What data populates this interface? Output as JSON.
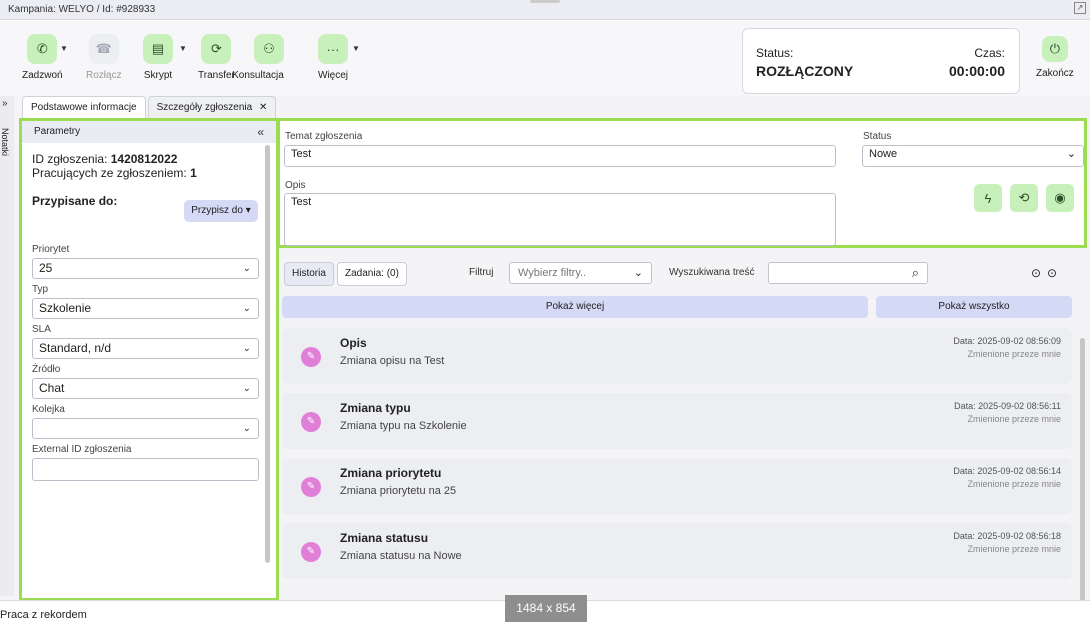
{
  "window": {
    "title": "Kampania: WELYO / Id: #928933",
    "expand_icon": "expand-icon"
  },
  "toolbar": {
    "call": "Zadzwoń",
    "hangup": "Rozłącz",
    "script": "Skrypt",
    "transfer": "Transfer",
    "consult": "Konsultacja",
    "more": "Więcej",
    "end": "Zakończ"
  },
  "status": {
    "status_label": "Status:",
    "status_value": "ROZŁĄCZONY",
    "time_label": "Czas:",
    "time_value": "00:00:00"
  },
  "side": {
    "notes_label": "Notatki",
    "toggle": "»"
  },
  "tabs": [
    {
      "label": "Podstawowe informacje"
    },
    {
      "label": "Szczegóły zgłoszenia",
      "close": "✕"
    }
  ],
  "params": {
    "header": "Parametry",
    "collapse": "«",
    "id_label": "ID zgłoszenia:",
    "id_value": "1420812022",
    "working_label": "Pracujących ze zgłoszeniem:",
    "working_value": "1",
    "assigned_label": "Przypisane do:",
    "assign_button": "Przypisz do ▾",
    "priority_label": "Priorytet",
    "priority_value": "25",
    "type_label": "Typ",
    "type_value": "Szkolenie",
    "sla_label": "SLA",
    "sla_value": "Standard, n/d",
    "source_label": "Źródło",
    "source_value": "Chat",
    "queue_label": "Kolejka",
    "queue_value": "",
    "external_label": "External ID zgłoszenia",
    "external_value": ""
  },
  "ticket": {
    "subject_label": "Temat zgłoszenia",
    "subject_value": "Test",
    "status_label": "Status",
    "status_value": "Nowe",
    "desc_label": "Opis",
    "desc_value": "Test"
  },
  "history": {
    "tab_history": "Historia",
    "tab_tasks": "Zadania: (0)",
    "filter_label": "Filtruj",
    "filter_placeholder": "Wybierz filtry..",
    "search_label": "Wyszukiwana treść",
    "search_value": "",
    "show_more": "Pokaż więcej",
    "show_all": "Pokaż wszystko",
    "events": [
      {
        "title": "Opis",
        "desc": "Zmiana opisu na Test",
        "date": "Data: 2025-09-02 08:56:09",
        "by": "Zmienione przeze mnie"
      },
      {
        "title": "Zmiana typu",
        "desc": "Zmiana typu na Szkolenie",
        "date": "Data: 2025-09-02 08:56:11",
        "by": "Zmienione przeze mnie"
      },
      {
        "title": "Zmiana priorytetu",
        "desc": "Zmiana priorytetu na 25",
        "date": "Data: 2025-09-02 08:56:14",
        "by": "Zmienione przeze mnie"
      },
      {
        "title": "Zmiana statusu",
        "desc": "Zmiana statusu na Nowe",
        "date": "Data: 2025-09-02 08:56:18",
        "by": "Zmienione przeze mnie"
      }
    ]
  },
  "footer": {
    "text": "Praca z rekordem"
  },
  "overlay": {
    "dimensions": "1484 x 854"
  },
  "colors": {
    "accent_green": "#c8f0ba",
    "highlight_border": "#9bdc50",
    "button_blue": "#d4d9f6",
    "event_icon": "#e07fd7"
  }
}
